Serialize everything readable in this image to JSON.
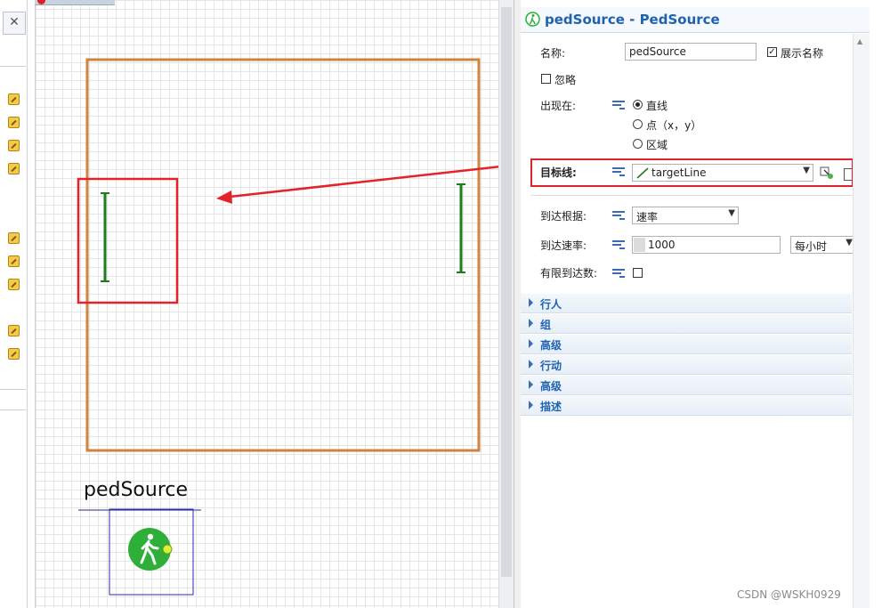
{
  "panel": {
    "title": "pedSource - PedSource",
    "name_label": "名称:",
    "name_value": "pedSource",
    "show_name_label": "展示名称",
    "show_name_checked": true,
    "ignore_label": "忽略",
    "appear_label": "出现在:",
    "appear_options": [
      "直线",
      "点（x，y）",
      "区域"
    ],
    "appear_selected": "直线",
    "target_label": "目标线:",
    "target_value": "targetLine",
    "arrival_label": "到达根据:",
    "arrival_value": "速率",
    "rate_label": "到达速率:",
    "rate_value": "1000",
    "rate_unit": "每小时",
    "limited_label": "有限到达数:",
    "sections": [
      "行人",
      "组",
      "高级",
      "行动",
      "高级",
      "描述"
    ]
  },
  "canvas": {
    "agent_label": "pedSource"
  },
  "watermark": "CSDN @WSKH0929",
  "colors": {
    "accent": "#1f62b0",
    "highlight": "#e3232c",
    "wall": "#cd853f",
    "line": "#1e7b1e",
    "agent": "#2eaf3a"
  }
}
